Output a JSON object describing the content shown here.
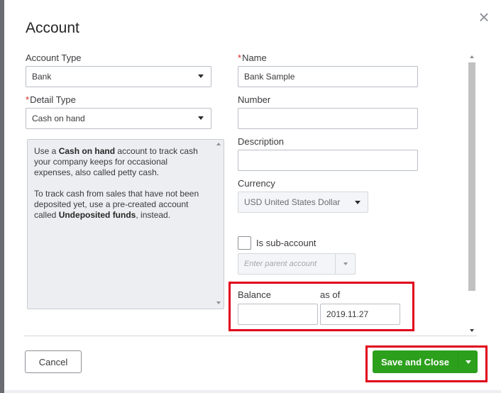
{
  "dialog": {
    "title": "Account",
    "close_icon": "close-icon"
  },
  "account_type": {
    "label": "Account Type",
    "value": "Bank"
  },
  "detail_type": {
    "required_mark": "*",
    "label": "Detail Type",
    "value": "Cash on hand"
  },
  "detail_description": {
    "p1_pre": "Use a ",
    "p1_bold": "Cash on hand",
    "p1_post": " account to track cash your company keeps for occasional expenses, also called petty cash.",
    "p2_pre": "To track cash from sales that have not been deposited yet, use a pre-created account called ",
    "p2_bold": "Undeposited funds",
    "p2_post": ", instead."
  },
  "name": {
    "required_mark": "*",
    "label": "Name",
    "value": "Bank Sample"
  },
  "number": {
    "label": "Number",
    "value": ""
  },
  "description": {
    "label": "Description",
    "value": ""
  },
  "currency": {
    "label": "Currency",
    "value": "USD United States Dollar"
  },
  "sub_account": {
    "label": "Is sub-account",
    "checked": false,
    "parent_placeholder": "Enter parent account"
  },
  "balance": {
    "label": "Balance",
    "value": "",
    "as_of_label": "as of",
    "as_of_value": "2019.11.27"
  },
  "footer": {
    "cancel_label": "Cancel",
    "save_label": "Save and Close"
  },
  "colors": {
    "primary_button": "#2ca01c",
    "highlight": "#e0001b",
    "required": "#d52b1e"
  }
}
